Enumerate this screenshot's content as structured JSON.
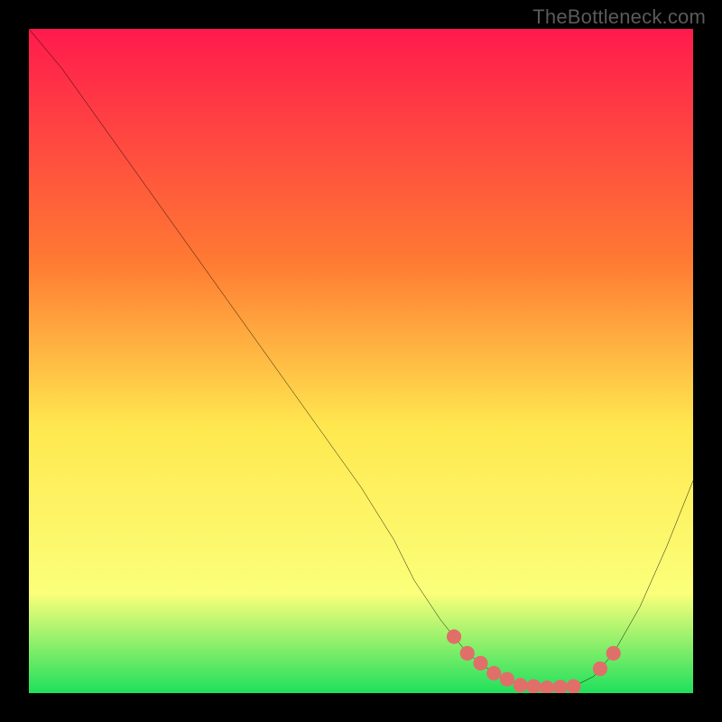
{
  "watermark": "TheBottleneck.com",
  "colors": {
    "background": "#000000",
    "curve": "#000000",
    "markers": "#e06f6a",
    "gradient_top": "#ff1a4d",
    "gradient_mid1": "#ff7a33",
    "gradient_mid2": "#ffe84f",
    "gradient_mid3": "#fbff7a",
    "gradient_bottom": "#1fe05c"
  },
  "chart_data": {
    "type": "line",
    "title": "",
    "xlabel": "",
    "ylabel": "",
    "xlim": [
      0,
      100
    ],
    "ylim": [
      0,
      100
    ],
    "curve": {
      "x": [
        0,
        5,
        10,
        15,
        20,
        25,
        30,
        35,
        40,
        45,
        50,
        55,
        58,
        62,
        66,
        70,
        74,
        78,
        82,
        85,
        88,
        92,
        96,
        100
      ],
      "y": [
        100,
        94,
        87,
        80,
        73,
        66,
        59,
        52,
        45,
        38,
        31,
        23,
        17,
        11,
        6,
        3,
        1.2,
        0.8,
        1.0,
        2.5,
        6,
        13,
        22,
        32
      ]
    },
    "markers_x": [
      64,
      66,
      68,
      70,
      72,
      74,
      76,
      78,
      80,
      82,
      86,
      88
    ],
    "markers_y_series": "curve",
    "marker_radius": 1.1,
    "annotations": []
  }
}
